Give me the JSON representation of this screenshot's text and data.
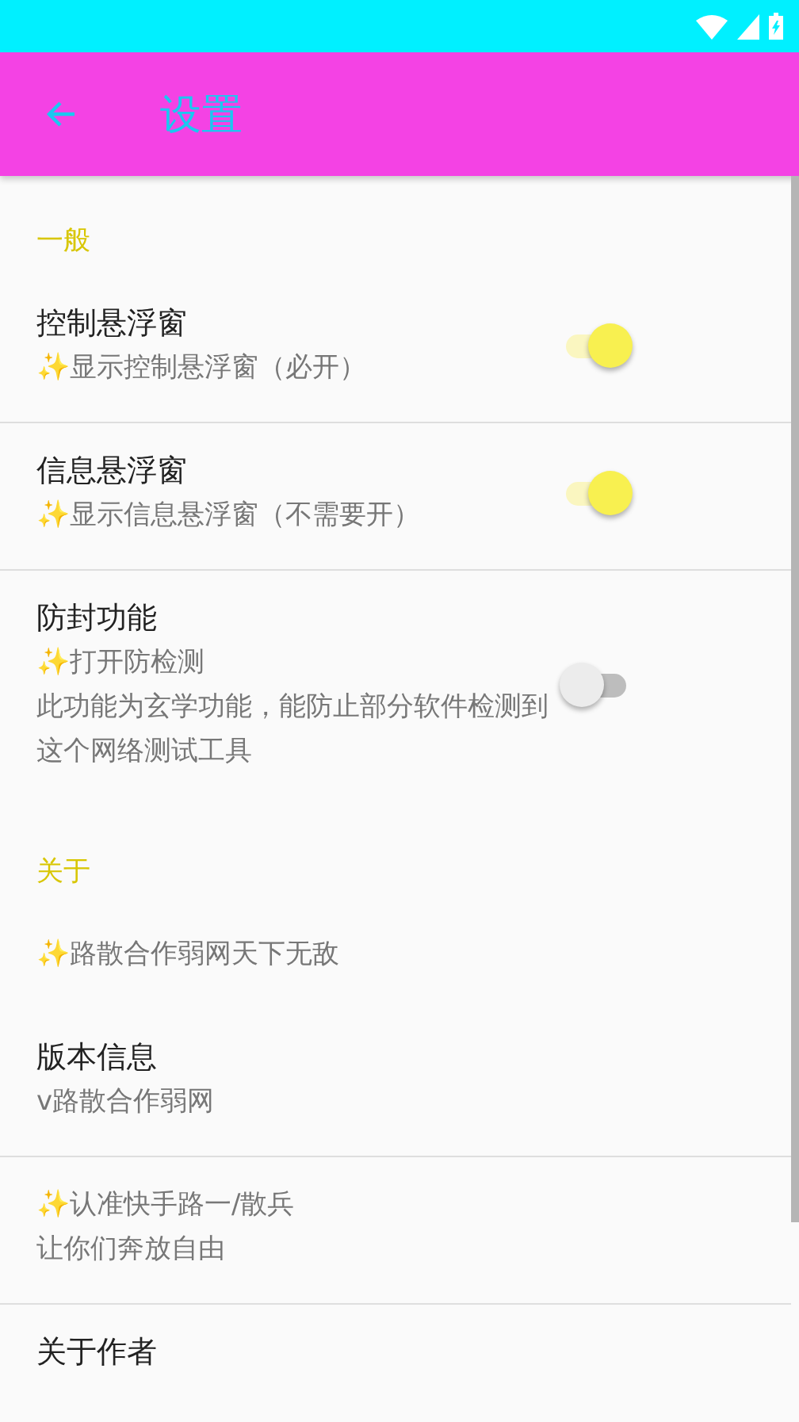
{
  "app_bar": {
    "title": "设置"
  },
  "sections": [
    {
      "header": "一般",
      "items": [
        {
          "kind": "switch",
          "title": "控制悬浮窗",
          "summary": "✨显示控制悬浮窗（必开）",
          "on": true,
          "divider": true
        },
        {
          "kind": "switch",
          "title": "信息悬浮窗",
          "summary": "✨显示信息悬浮窗（不需要开）",
          "on": true,
          "divider": true
        },
        {
          "kind": "switch",
          "title": "防封功能",
          "summary": "✨打开防检测",
          "note": "此功能为玄学功能，能防止部分软件检测到这个网络测试工具",
          "on": false,
          "divider": false
        }
      ]
    },
    {
      "header": "关于",
      "items": [
        {
          "kind": "text",
          "summary": "✨路散合作弱网天下无敌",
          "divider": false
        },
        {
          "kind": "text",
          "title": "版本信息",
          "summary": "v路散合作弱网",
          "divider": true
        },
        {
          "kind": "text",
          "summary": "✨认准快手路一/散兵",
          "note": "让你们奔放自由",
          "divider": true
        },
        {
          "kind": "text",
          "title": "关于作者",
          "divider": false
        }
      ]
    }
  ]
}
